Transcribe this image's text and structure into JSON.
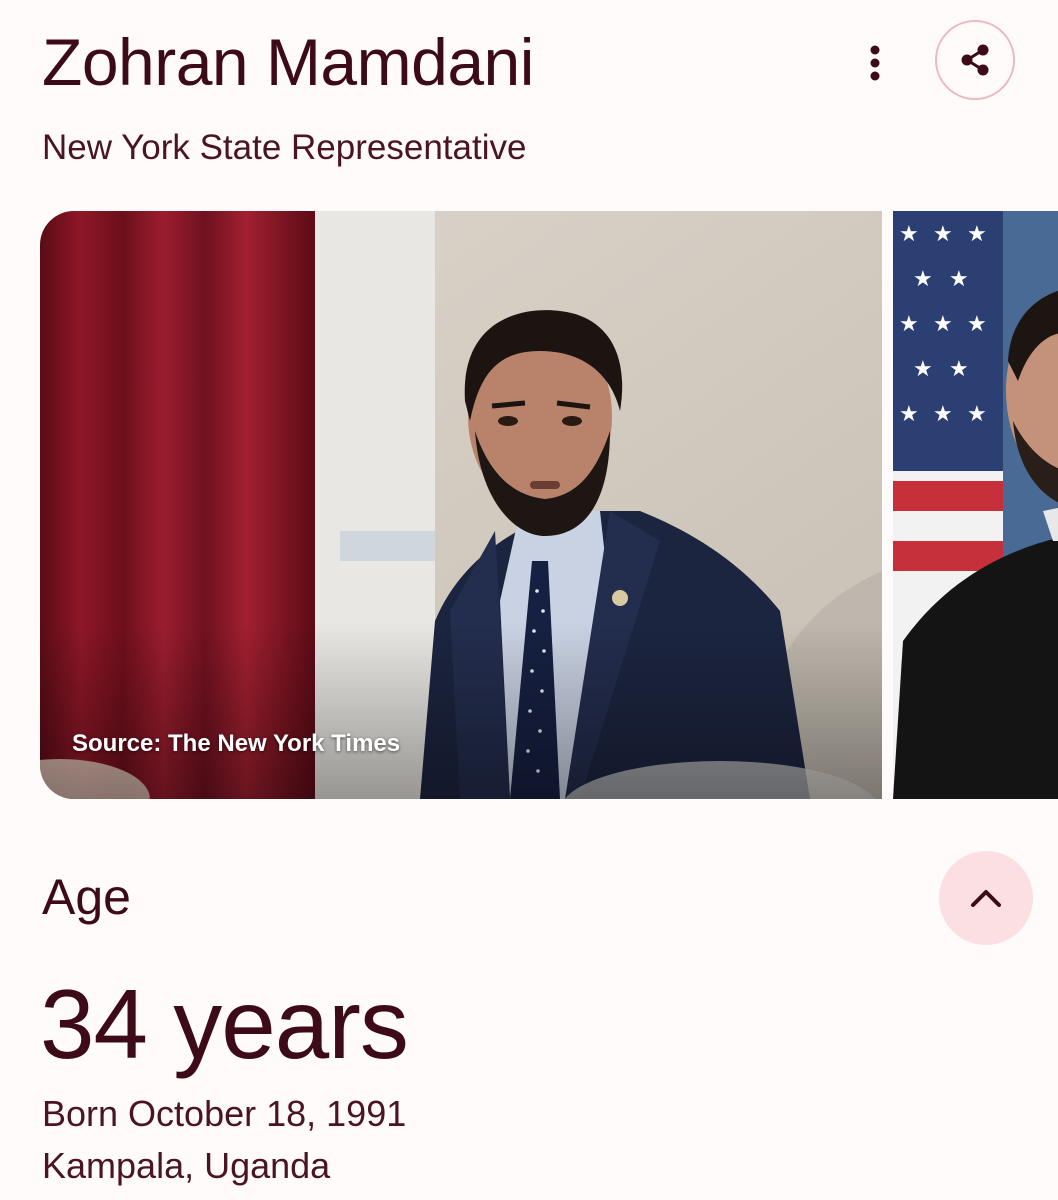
{
  "header": {
    "name": "Zohran Mamdani",
    "subtitle": "New York State Representative",
    "more_icon": "more-vert-icon",
    "share_icon": "share-icon"
  },
  "carousel": {
    "images": [
      {
        "caption": "Source: The New York Times"
      },
      {
        "caption": ""
      }
    ]
  },
  "age_section": {
    "label": "Age",
    "value": "34 years",
    "born": "Born October 18, 1991",
    "birthplace": "Kampala, Uganda",
    "toggle_icon": "chevron-up-icon"
  },
  "colors": {
    "text_primary": "#3d0b18",
    "background": "#fffbfb",
    "share_border": "#eeb8c2",
    "toggle_bg": "#fbdfe2"
  }
}
